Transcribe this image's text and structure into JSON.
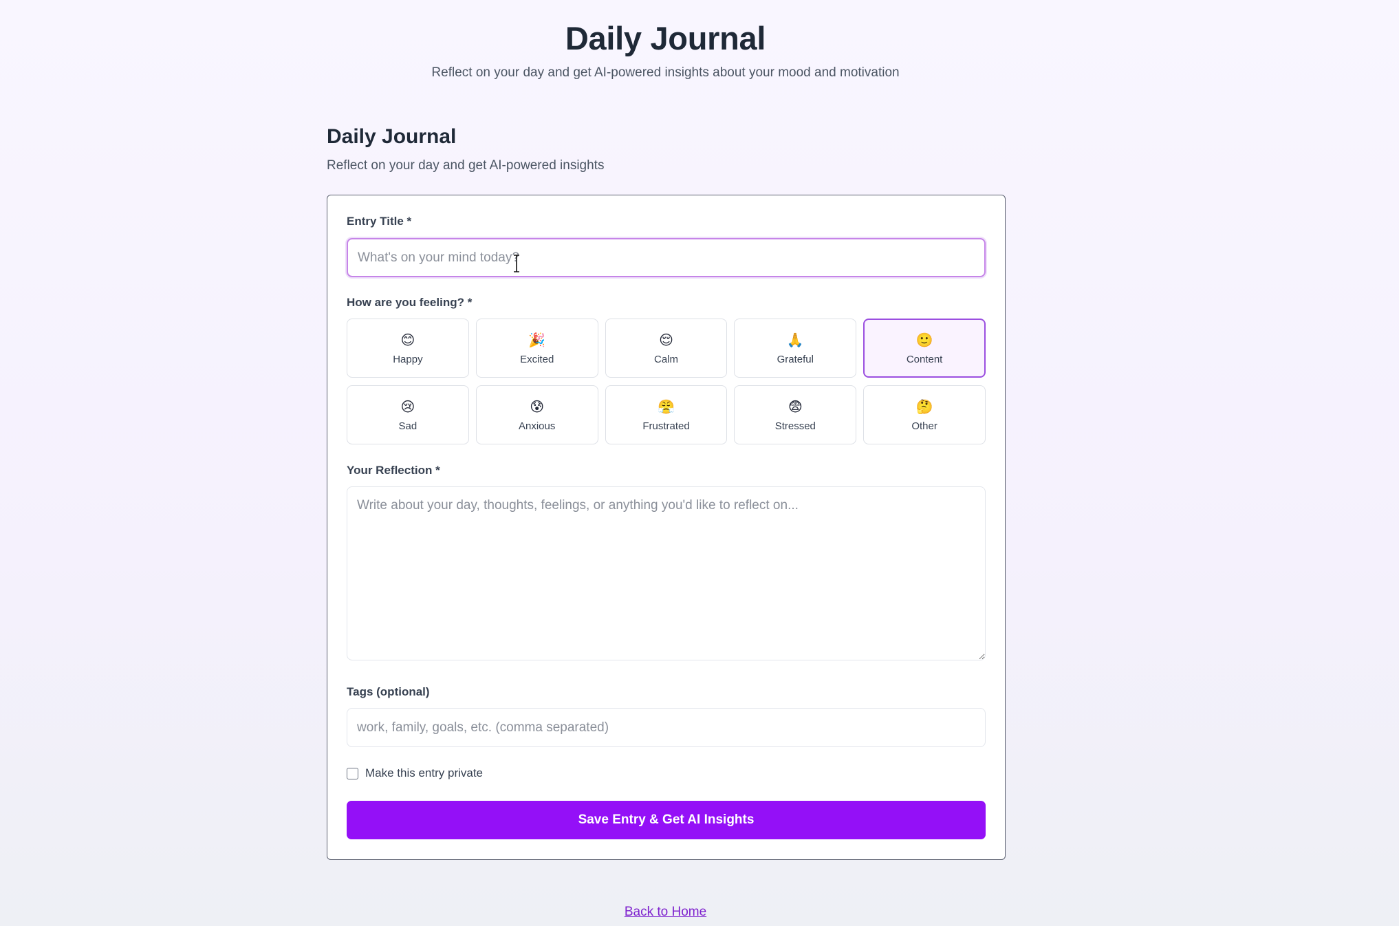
{
  "header": {
    "title": "Daily Journal",
    "subtitle": "Reflect on your day and get AI-powered insights about your mood and motivation"
  },
  "section": {
    "title": "Daily Journal",
    "subtitle": "Reflect on your day and get AI-powered insights"
  },
  "form": {
    "title_label": "Entry Title *",
    "title_placeholder": "What's on your mind today?",
    "title_value": "",
    "mood_label": "How are you feeling? *",
    "moods": [
      {
        "emoji": "😊",
        "label": "Happy",
        "selected": false
      },
      {
        "emoji": "🎉",
        "label": "Excited",
        "selected": false
      },
      {
        "emoji": "😌",
        "label": "Calm",
        "selected": false
      },
      {
        "emoji": "🙏",
        "label": "Grateful",
        "selected": false
      },
      {
        "emoji": "🙂",
        "label": "Content",
        "selected": true
      },
      {
        "emoji": "😢",
        "label": "Sad",
        "selected": false
      },
      {
        "emoji": "😰",
        "label": "Anxious",
        "selected": false
      },
      {
        "emoji": "😤",
        "label": "Frustrated",
        "selected": false
      },
      {
        "emoji": "😨",
        "label": "Stressed",
        "selected": false
      },
      {
        "emoji": "🤔",
        "label": "Other",
        "selected": false
      }
    ],
    "reflection_label": "Your Reflection *",
    "reflection_placeholder": "Write about your day, thoughts, feelings, or anything you'd like to reflect on...",
    "reflection_value": "",
    "tags_label": "Tags (optional)",
    "tags_placeholder": "work, family, goals, etc. (comma separated)",
    "tags_value": "",
    "private_label": "Make this entry private",
    "private_checked": false,
    "submit_label": "Save Entry & Get AI Insights"
  },
  "footer": {
    "back_link": "Back to Home"
  },
  "colors": {
    "accent": "#9410f7",
    "selected_border": "#9b4fe0",
    "link": "#7e22ce"
  }
}
